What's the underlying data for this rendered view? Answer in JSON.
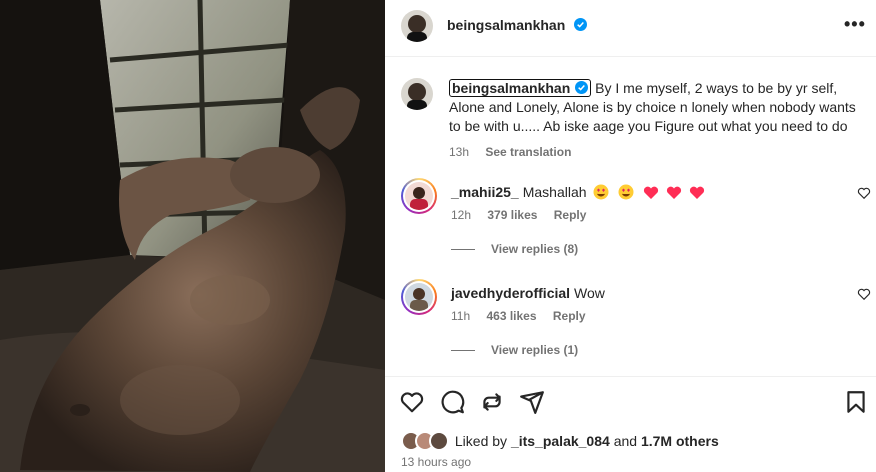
{
  "post": {
    "username": "beingsalmankhan",
    "more_icon": "more-horizontal-icon"
  },
  "caption": {
    "username": "beingsalmankhan",
    "text": "By I me myself, 2 ways to be by yr self, Alone and Lonely, Alone is by choice n lonely when nobody wants to be with u..... Ab iske aage you Figure out what you need to do",
    "time": "13h",
    "see_translation": "See translation"
  },
  "comments": [
    {
      "username": "_mahii25_",
      "text": "Mashallah",
      "time": "12h",
      "likes": "379 likes",
      "reply": "Reply",
      "view_replies": "View replies (8)"
    },
    {
      "username": "javedhyderofficial",
      "text": "Wow",
      "time": "11h",
      "likes": "463 likes",
      "reply": "Reply",
      "view_replies": "View replies (1)"
    }
  ],
  "likes": {
    "prefix": "Liked by",
    "user": "_its_palak_084",
    "and": "and",
    "count": "1.7M others"
  },
  "time_ago": "13 hours ago",
  "colors": {
    "verified": "#0095f6",
    "heart_emoji": "#ff2d55",
    "meta_text": "#737373"
  }
}
